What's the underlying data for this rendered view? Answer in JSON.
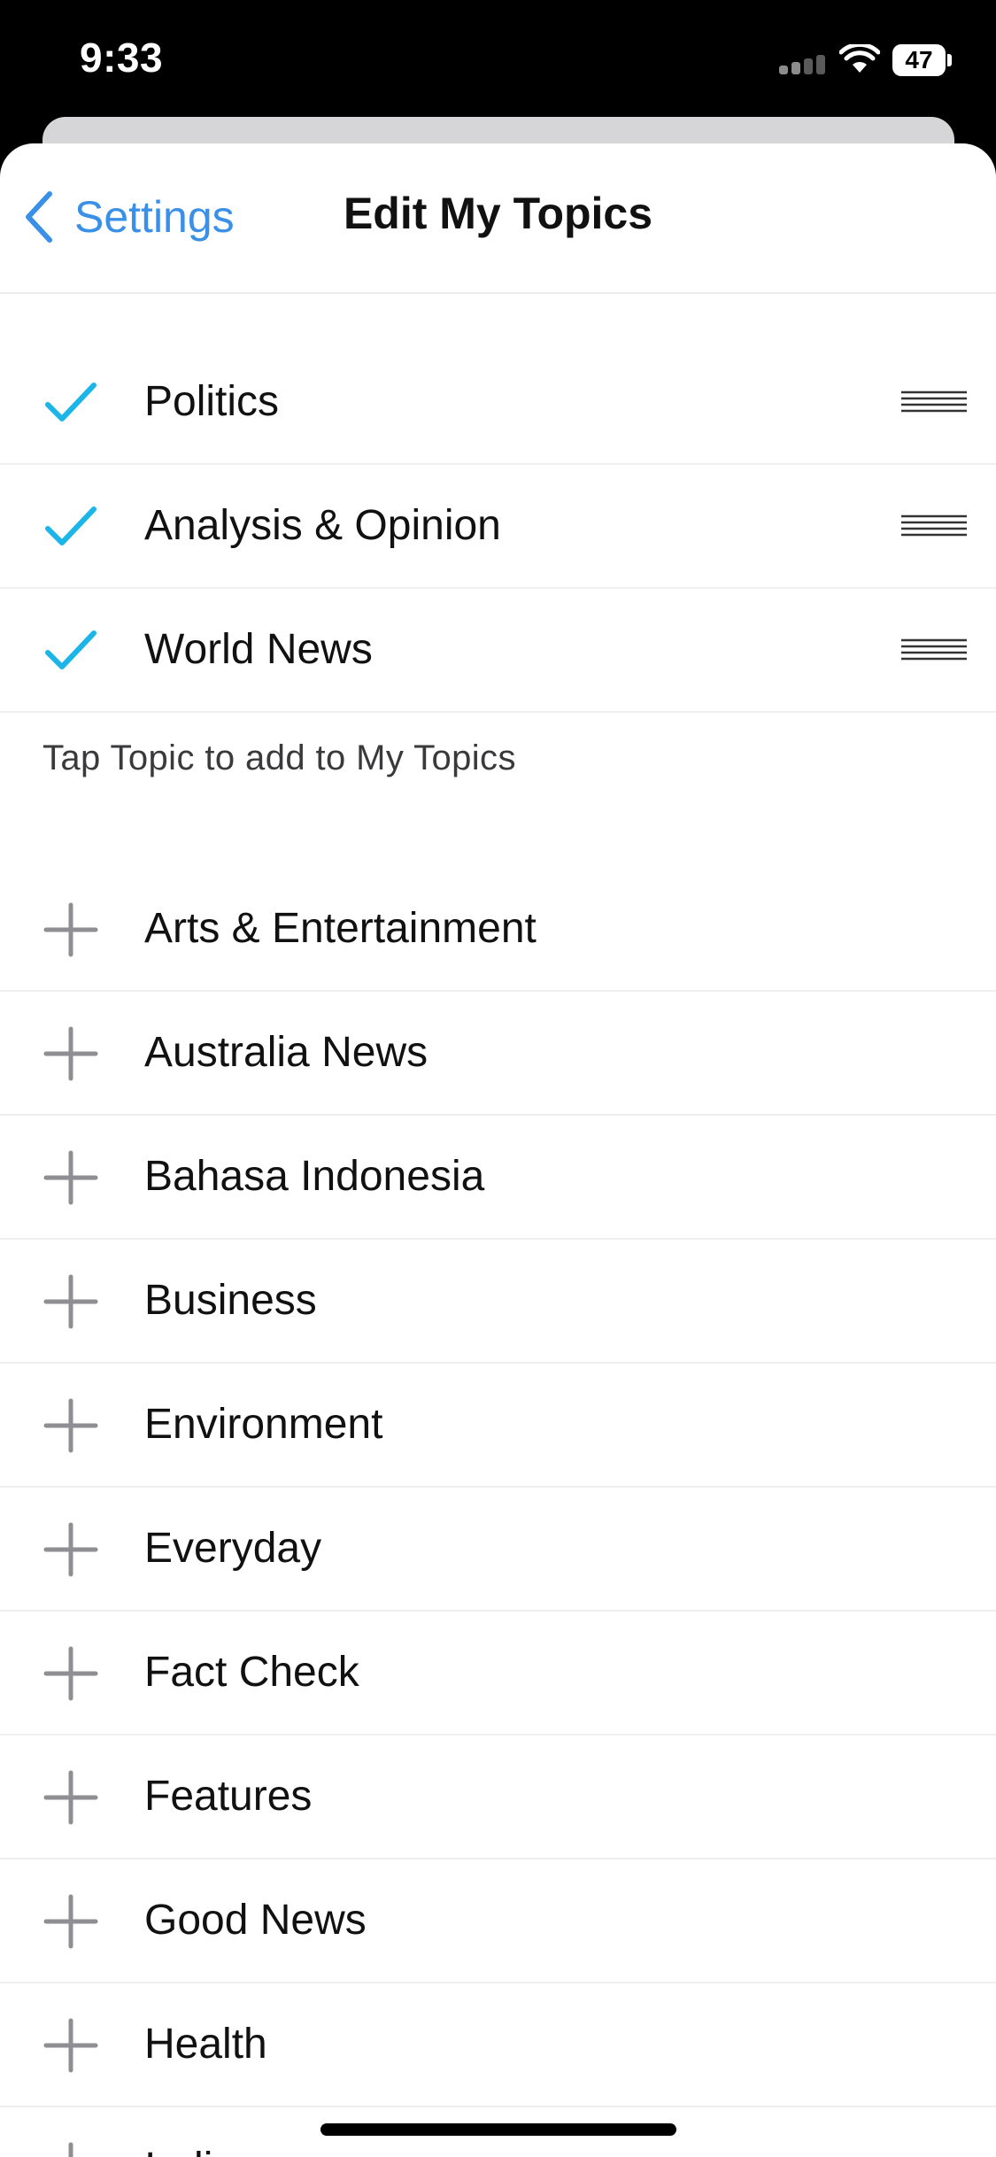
{
  "status_bar": {
    "time": "9:33",
    "battery_level": "47"
  },
  "nav": {
    "back_label": "Settings",
    "title": "Edit My Topics"
  },
  "colors": {
    "accent": "#3a90e6",
    "check": "#1bb5e8",
    "plus": "#8e8e93"
  },
  "my_topics": [
    {
      "label": "Politics",
      "icon": "checkmark-icon"
    },
    {
      "label": "Analysis & Opinion",
      "icon": "checkmark-icon"
    },
    {
      "label": "World News",
      "icon": "checkmark-icon"
    }
  ],
  "hint": "Tap Topic to add to My Topics",
  "available_topics": [
    {
      "label": "Arts & Entertainment",
      "icon": "plus-icon"
    },
    {
      "label": "Australia News",
      "icon": "plus-icon"
    },
    {
      "label": "Bahasa Indonesia",
      "icon": "plus-icon"
    },
    {
      "label": "Business",
      "icon": "plus-icon"
    },
    {
      "label": "Environment",
      "icon": "plus-icon"
    },
    {
      "label": "Everyday",
      "icon": "plus-icon"
    },
    {
      "label": "Fact Check",
      "icon": "plus-icon"
    },
    {
      "label": "Features",
      "icon": "plus-icon"
    },
    {
      "label": "Good News",
      "icon": "plus-icon"
    },
    {
      "label": "Health",
      "icon": "plus-icon"
    },
    {
      "label": "Indigenous",
      "icon": "plus-icon"
    }
  ]
}
